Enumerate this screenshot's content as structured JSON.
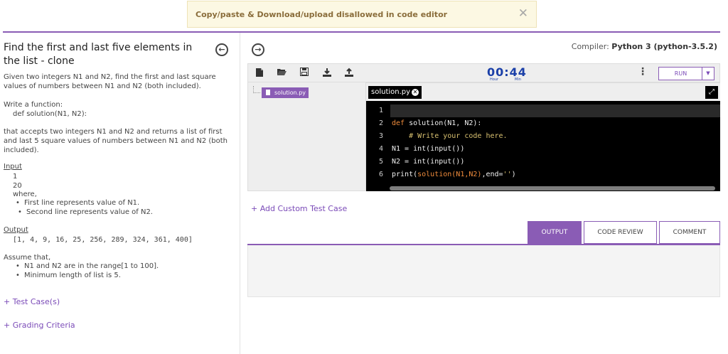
{
  "banner": {
    "message": "Copy/paste & Download/upload disallowed in code editor",
    "close_glyph": "✕"
  },
  "problem": {
    "title": "Find the first and last five elements in the list - clone",
    "intro": "Given two integers N1 and N2, find the first and last square values of numbers between N1 and N2 (both included).",
    "write_function": "Write a function:",
    "signature": "def solution(N1, N2):",
    "returns": "that accepts two integers N1 and N2 and returns a list of first and last 5 square values of numbers between N1 and N2 (both included).",
    "input_heading": "Input",
    "input_line1": "1",
    "input_line2": "20",
    "where": "where,",
    "input_bullets": [
      "First line represents value of N1.",
      "Second line represents value of N2."
    ],
    "output_heading": "Output",
    "output_value": "[1, 4, 9, 16, 25, 256, 289, 324, 361, 400]",
    "assume": "Assume that,",
    "assume_bullets": [
      "N1 and N2 are in the range[1 to 100].",
      "Minimum length of list is 5."
    ],
    "test_cases_link": "+ Test Case(s)",
    "grading_link": "+ Grading Criteria"
  },
  "compiler": {
    "label": "Compiler:",
    "value": "Python 3 (python-3.5.2)"
  },
  "toolbar": {
    "timer": {
      "hours": "00",
      "minutes": "44",
      "separator": ":",
      "hour_label": "Hour",
      "min_label": "Min"
    },
    "run_label": "RUN",
    "kebab": "⋮"
  },
  "file_tree": {
    "file": "solution.py"
  },
  "editor": {
    "tab": "solution.py",
    "line_numbers": [
      "1",
      "2",
      "3",
      "4",
      "5",
      "6"
    ],
    "code": {
      "l2_kw": "def",
      "l2_rest": " solution(N1, N2):",
      "l3": "    # Write your code here.",
      "l4": "N1 = int(input())",
      "l5": "N2 = int(input())",
      "l6_a": "print(",
      "l6_b": "solution(N1,N2)",
      "l6_c": ",end=",
      "l6_d": "''",
      "l6_e": ")"
    }
  },
  "add_custom_test": "+ Add Custom Test Case",
  "output_tabs": [
    "OUTPUT",
    "CODE REVIEW",
    "COMMENT"
  ],
  "colors": {
    "accent": "#8a5cb5",
    "timer": "#1a3fa8",
    "banner_bg": "#fcf8e3",
    "banner_text": "#8a6d3b"
  },
  "icons": [
    "new-file-icon",
    "open-folder-icon",
    "save-icon",
    "download-icon",
    "upload-icon",
    "collapse-left-icon",
    "expand-right-icon",
    "fullscreen-icon",
    "close-icon"
  ]
}
